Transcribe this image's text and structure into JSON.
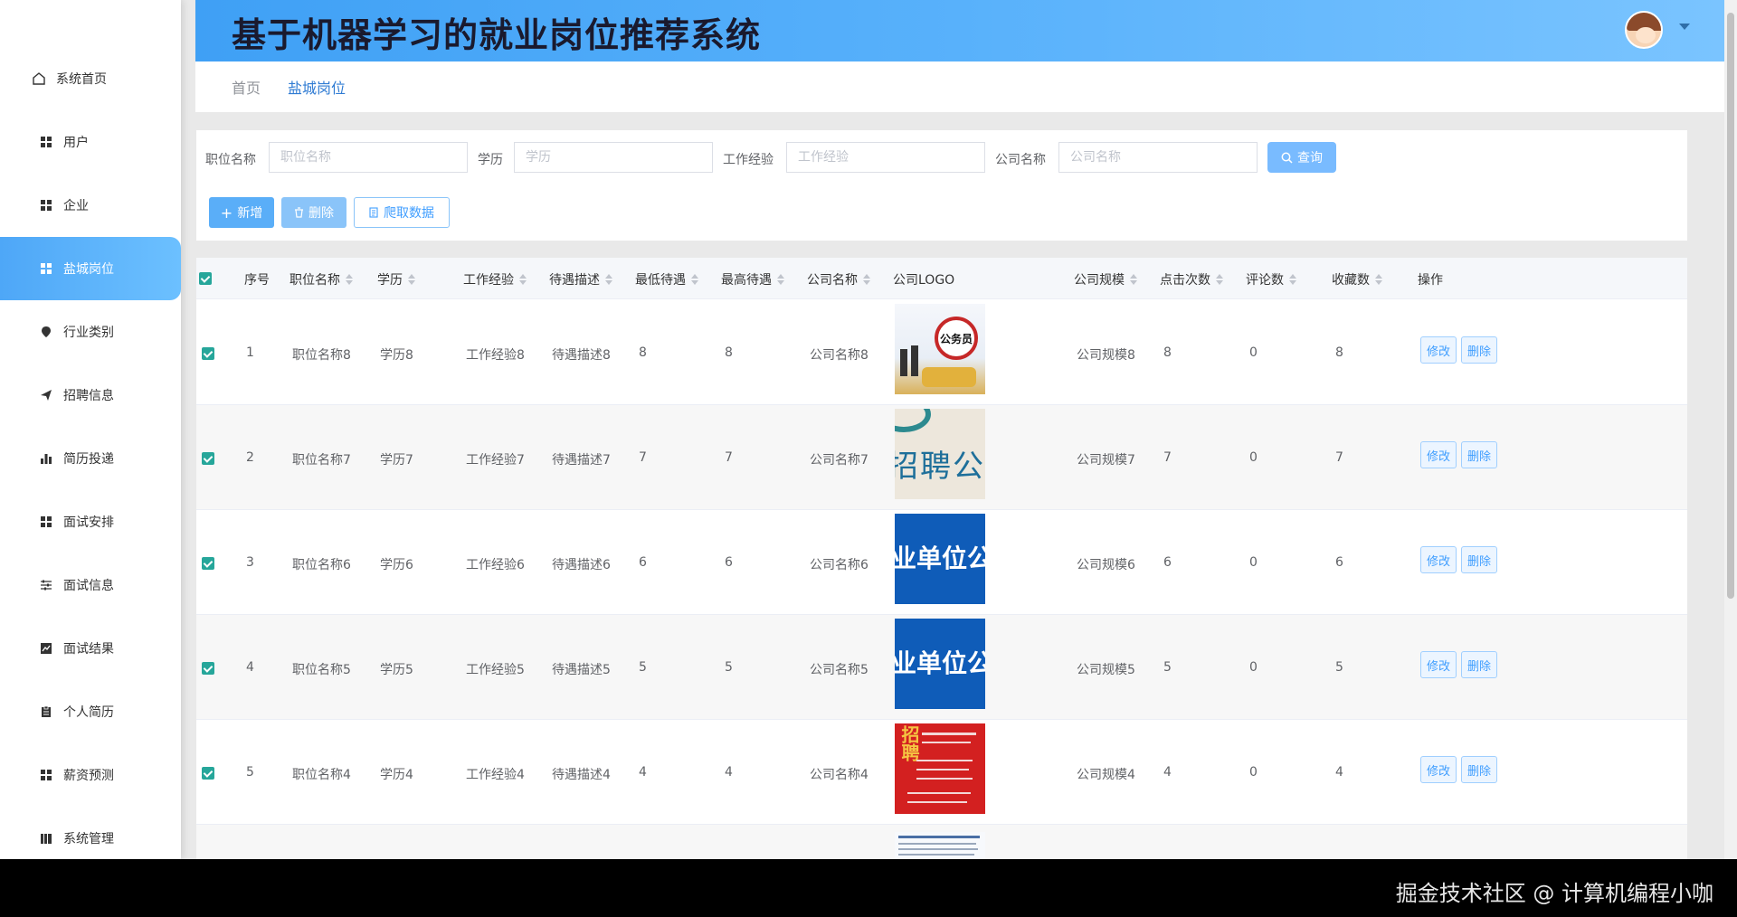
{
  "app": {
    "title": "基于机器学习的就业岗位推荐系统"
  },
  "sidebar": {
    "items": [
      {
        "label": "系统首页",
        "icon": "home-icon"
      },
      {
        "label": "用户",
        "icon": "grid-icon"
      },
      {
        "label": "企业",
        "icon": "grid-icon"
      },
      {
        "label": "盐城岗位",
        "icon": "grid-icon",
        "active": true
      },
      {
        "label": "行业类别",
        "icon": "pin-icon"
      },
      {
        "label": "招聘信息",
        "icon": "send-icon"
      },
      {
        "label": "简历投递",
        "icon": "bar-chart-icon"
      },
      {
        "label": "面试安排",
        "icon": "grid-icon"
      },
      {
        "label": "面试信息",
        "icon": "sliders-icon"
      },
      {
        "label": "面试结果",
        "icon": "line-chart-icon"
      },
      {
        "label": "个人简历",
        "icon": "clipboard-icon"
      },
      {
        "label": "薪资预测",
        "icon": "grid-icon"
      },
      {
        "label": "系统管理",
        "icon": "book-icon"
      }
    ]
  },
  "breadcrumb": {
    "home": "首页",
    "current": "盐城岗位"
  },
  "search": {
    "fields": [
      {
        "label": "职位名称",
        "placeholder": "职位名称"
      },
      {
        "label": "学历",
        "placeholder": "学历"
      },
      {
        "label": "工作经验",
        "placeholder": "工作经验"
      },
      {
        "label": "公司名称",
        "placeholder": "公司名称"
      }
    ],
    "query_label": "查询"
  },
  "actions": {
    "add": "新增",
    "delete": "删除",
    "crawl": "爬取数据"
  },
  "table": {
    "headers": {
      "index": "序号",
      "title": "职位名称",
      "education": "学历",
      "experience": "工作经验",
      "benefits": "待遇描述",
      "min_salary": "最低待遇",
      "max_salary": "最高待遇",
      "company": "公司名称",
      "logo": "公司LOGO",
      "scale": "公司规模",
      "clicks": "点击次数",
      "comments": "评论数",
      "favorites": "收藏数",
      "ops": "操作"
    },
    "edit_label": "修改",
    "delete_label": "删除",
    "rows": [
      {
        "index": "1",
        "title": "职位名称8",
        "education": "学历8",
        "experience": "工作经验8",
        "benefits": "待遇描述8",
        "min_salary": "8",
        "max_salary": "8",
        "company": "公司名称8",
        "logo_text": "公务员",
        "scale": "公司规模8",
        "clicks": "8",
        "comments": "0",
        "favorites": "8"
      },
      {
        "index": "2",
        "title": "职位名称7",
        "education": "学历7",
        "experience": "工作经验7",
        "benefits": "待遇描述7",
        "min_salary": "7",
        "max_salary": "7",
        "company": "公司名称7",
        "logo_text": "招聘公告",
        "scale": "公司规模7",
        "clicks": "7",
        "comments": "0",
        "favorites": "7"
      },
      {
        "index": "3",
        "title": "职位名称6",
        "education": "学历6",
        "experience": "工作经验6",
        "benefits": "待遇描述6",
        "min_salary": "6",
        "max_salary": "6",
        "company": "公司名称6",
        "logo_text": "业单位公",
        "scale": "公司规模6",
        "clicks": "6",
        "comments": "0",
        "favorites": "6"
      },
      {
        "index": "4",
        "title": "职位名称5",
        "education": "学历5",
        "experience": "工作经验5",
        "benefits": "待遇描述5",
        "min_salary": "5",
        "max_salary": "5",
        "company": "公司名称5",
        "logo_text": "业单位公",
        "scale": "公司规模5",
        "clicks": "5",
        "comments": "0",
        "favorites": "5"
      },
      {
        "index": "5",
        "title": "职位名称4",
        "education": "学历4",
        "experience": "工作经验4",
        "benefits": "待遇描述4",
        "min_salary": "4",
        "max_salary": "4",
        "company": "公司名称4",
        "logo_text": "招聘",
        "scale": "公司规模4",
        "clicks": "4",
        "comments": "0",
        "favorites": "4"
      }
    ]
  },
  "watermark": "掘金技术社区 @ 计算机编程小咖",
  "colors": {
    "accent": "#409eff",
    "header": "#58b1fb",
    "check": "#26a69a"
  }
}
